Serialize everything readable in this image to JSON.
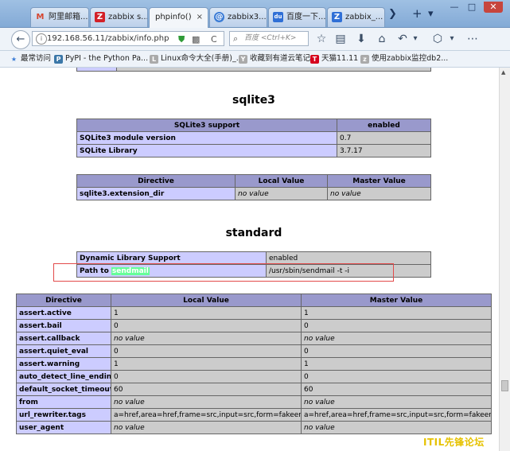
{
  "browser": {
    "tabs": [
      {
        "label": "阿里邮箱...",
        "icon": "M",
        "color": "#d6452e"
      },
      {
        "label": "zabbix s...",
        "icon": "Z",
        "color": "#d32028"
      },
      {
        "label": "phpinfo()",
        "icon": "",
        "color": "#999999"
      },
      {
        "label": "zabbix3....",
        "icon": "@",
        "color": "#3a7bd5"
      },
      {
        "label": "百度一下...",
        "icon": "du",
        "color": "#2f6fd6"
      },
      {
        "label": "zabbix_...",
        "icon": "Z",
        "color": "#2f6fd6"
      }
    ],
    "active_tab_close": "×",
    "tab_close": "×",
    "new_tab": "+",
    "tab_list": "▾",
    "window": {
      "minimize": "—",
      "maximize": "□",
      "close": "✕"
    },
    "nav": {
      "back": "←",
      "url": "192.168.56.11/zabbix/info.php",
      "reload": "C",
      "search_engine": "百度",
      "search_placeholder": "<Ctrl+K>"
    },
    "toolbar_icons": [
      "☆",
      "▤",
      "⬇",
      "⌂",
      "↶",
      "▾",
      "⬡",
      "▾",
      "⋯"
    ],
    "bookmarks": [
      {
        "label": "最常访问",
        "icon": "★",
        "color": "#3a7bd5"
      },
      {
        "label": "PyPI - the Python Pa...",
        "icon": "P",
        "color": "#3b77a8"
      },
      {
        "label": "Linux命令大全(手册)_...",
        "icon": "L",
        "color": "#888888"
      },
      {
        "label": "收藏到有道云笔记",
        "icon": "Y",
        "color": "#888888"
      },
      {
        "label": "天猫11.11",
        "icon": "T",
        "color": "#d6001c"
      },
      {
        "label": "使用zabbix监控db2...",
        "icon": "z",
        "color": "#888888"
      }
    ]
  },
  "content": {
    "sqlite_title": "sqlite3",
    "sqlite_support": {
      "headers": [
        "SQLite3 support",
        "enabled"
      ],
      "rows": [
        [
          "SQLite3 module version",
          "0.7"
        ],
        [
          "SQLite Library",
          "3.7.17"
        ]
      ]
    },
    "sqlite_directive": {
      "headers": [
        "Directive",
        "Local Value",
        "Master Value"
      ],
      "rows": [
        [
          "sqlite3.extension_dir",
          "no value",
          "no value"
        ]
      ]
    },
    "standard_title": "standard",
    "standard_support": {
      "rows": [
        [
          "Dynamic Library Support",
          "enabled"
        ]
      ],
      "sendmail_label_prefix": "Path to ",
      "sendmail_label_highlight": "sendmail",
      "sendmail_value": "/usr/sbin/sendmail -t -i"
    },
    "standard_directive": {
      "headers": [
        "Directive",
        "Local Value",
        "Master Value"
      ],
      "rows": [
        [
          "assert.active",
          "1",
          "1"
        ],
        [
          "assert.bail",
          "0",
          "0"
        ],
        [
          "assert.callback",
          "no value",
          "no value"
        ],
        [
          "assert.quiet_eval",
          "0",
          "0"
        ],
        [
          "assert.warning",
          "1",
          "1"
        ],
        [
          "auto_detect_line_endings",
          "0",
          "0"
        ],
        [
          "default_socket_timeout",
          "60",
          "60"
        ],
        [
          "from",
          "no value",
          "no value"
        ],
        [
          "url_rewriter.tags",
          "a=href,area=href,frame=src,input=src,form=fakeentry",
          "a=href,area=href,frame=src,input=src,form=fakeentry"
        ],
        [
          "user_agent",
          "no value",
          "no value"
        ]
      ]
    }
  },
  "watermark": "ITIL先锋论坛"
}
